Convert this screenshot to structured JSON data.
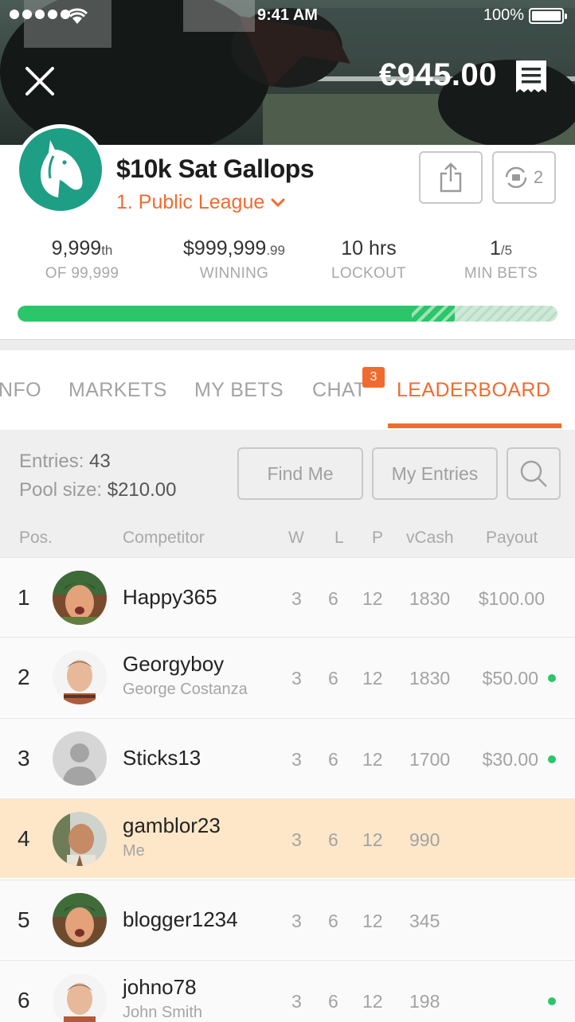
{
  "status_bar": {
    "time": "9:41 AM",
    "battery": "100%"
  },
  "header": {
    "balance": "€945.00"
  },
  "league": {
    "title": "$10k Sat Gallops",
    "subtitle": "1. Public League",
    "sync_count": "2"
  },
  "stats": [
    {
      "value": "9,999",
      "suffix": "th",
      "label": "OF 99,999"
    },
    {
      "value": "$999,999",
      "suffix": ".99",
      "label": "WINNING"
    },
    {
      "value": "10 hrs",
      "suffix": "",
      "label": "LOCKOUT"
    },
    {
      "value": "1",
      "suffix": "/5",
      "label": "MIN BETS"
    }
  ],
  "progress": {
    "solid": 0.73,
    "hatched": 0.81
  },
  "tabs": [
    "NFO",
    "MARKETS",
    "MY BETS",
    "CHAT",
    "LEADERBOARD"
  ],
  "chat_badge": "3",
  "pool": {
    "entries_label": "Entries:",
    "entries_value": "43",
    "pool_label": "Pool size:",
    "pool_value": "$210.00",
    "find_me": "Find Me",
    "my_entries": "My Entries"
  },
  "columns": {
    "pos": "Pos.",
    "competitor": "Competitor",
    "w": "W",
    "l": "L",
    "p": "P",
    "vcash": "vCash",
    "payout": "Payout"
  },
  "rows": [
    {
      "pos": "1",
      "name": "Happy365",
      "sub": "",
      "w": "3",
      "l": "6",
      "p": "12",
      "vcash": "1830",
      "payout": "$100.00",
      "dot": false
    },
    {
      "pos": "2",
      "name": "Georgyboy",
      "sub": "George Costanza",
      "w": "3",
      "l": "6",
      "p": "12",
      "vcash": "1830",
      "payout": "$50.00",
      "dot": true
    },
    {
      "pos": "3",
      "name": "Sticks13",
      "sub": "",
      "w": "3",
      "l": "6",
      "p": "12",
      "vcash": "1700",
      "payout": "$30.00",
      "dot": true
    },
    {
      "pos": "4",
      "name": "gamblor23",
      "sub": "Me",
      "w": "3",
      "l": "6",
      "p": "12",
      "vcash": "990",
      "payout": "",
      "dot": false
    },
    {
      "pos": "5",
      "name": "blogger1234",
      "sub": "",
      "w": "3",
      "l": "6",
      "p": "12",
      "vcash": "345",
      "payout": "",
      "dot": false
    },
    {
      "pos": "6",
      "name": "johno78",
      "sub": "John Smith",
      "w": "3",
      "l": "6",
      "p": "12",
      "vcash": "198",
      "payout": "",
      "dot": true
    }
  ],
  "colors": {
    "accent": "#f26b2e",
    "green": "#2bc66a",
    "teal": "#1f9e86",
    "me_row": "#fde7c8"
  }
}
